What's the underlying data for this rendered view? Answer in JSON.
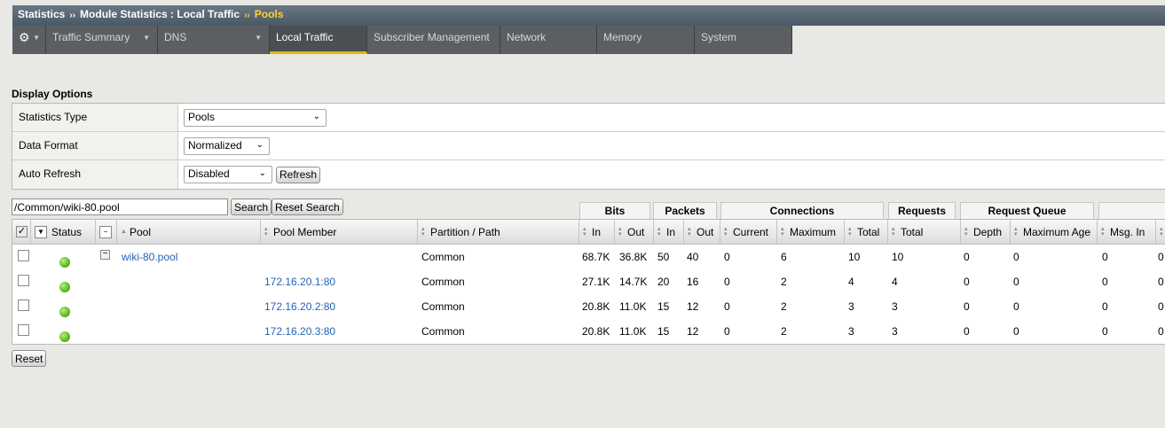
{
  "breadcrumb": {
    "root": "Statistics",
    "section": "Module Statistics : Local Traffic",
    "current": "Pools"
  },
  "nav": {
    "gear_icon": "gear-icon",
    "tabs": [
      {
        "label": "Traffic Summary",
        "dropdown": true
      },
      {
        "label": "DNS",
        "dropdown": true
      },
      {
        "label": "Local Traffic",
        "active": true
      },
      {
        "label": "Subscriber Management"
      },
      {
        "label": "Network"
      },
      {
        "label": "Memory"
      },
      {
        "label": "System"
      }
    ]
  },
  "display_options": {
    "heading": "Display Options",
    "statistics_type": {
      "label": "Statistics Type",
      "value": "Pools"
    },
    "data_format": {
      "label": "Data Format",
      "value": "Normalized"
    },
    "auto_refresh": {
      "label": "Auto Refresh",
      "value": "Disabled",
      "button": "Refresh"
    }
  },
  "search": {
    "value": "/Common/wiki-80.pool",
    "search_button": "Search",
    "reset_button": "Reset Search"
  },
  "groups": {
    "bits": "Bits",
    "packets": "Packets",
    "connections": "Connections",
    "requests": "Requests",
    "request_queue": "Request Queue"
  },
  "columns": {
    "status": "Status",
    "pool": "Pool",
    "pool_member": "Pool Member",
    "partition": "Partition / Path",
    "bits_in": "In",
    "bits_out": "Out",
    "pkts_in": "In",
    "pkts_out": "Out",
    "conn_current": "Current",
    "conn_max": "Maximum",
    "conn_total": "Total",
    "req_total": "Total",
    "q_depth": "Depth",
    "q_max_age": "Maximum Age",
    "msg_in": "Msg. In"
  },
  "rows": [
    {
      "pool": "wiki-80.pool",
      "member": "",
      "partition": "Common",
      "bits_in": "68.7K",
      "bits_out": "36.8K",
      "pkts_in": "50",
      "pkts_out": "40",
      "current": "0",
      "maximum": "6",
      "total": "10",
      "req_total": "10",
      "depth": "0",
      "max_age": "0",
      "msg_in": "0",
      "extra": "0"
    },
    {
      "pool": "",
      "member": "172.16.20.1:80",
      "partition": "Common",
      "bits_in": "27.1K",
      "bits_out": "14.7K",
      "pkts_in": "20",
      "pkts_out": "16",
      "current": "0",
      "maximum": "2",
      "total": "4",
      "req_total": "4",
      "depth": "0",
      "max_age": "0",
      "msg_in": "0",
      "extra": "0"
    },
    {
      "pool": "",
      "member": "172.16.20.2:80",
      "partition": "Common",
      "bits_in": "20.8K",
      "bits_out": "11.0K",
      "pkts_in": "15",
      "pkts_out": "12",
      "current": "0",
      "maximum": "2",
      "total": "3",
      "req_total": "3",
      "depth": "0",
      "max_age": "0",
      "msg_in": "0",
      "extra": "0"
    },
    {
      "pool": "",
      "member": "172.16.20.3:80",
      "partition": "Common",
      "bits_in": "20.8K",
      "bits_out": "11.0K",
      "pkts_in": "15",
      "pkts_out": "12",
      "current": "0",
      "maximum": "2",
      "total": "3",
      "req_total": "3",
      "depth": "0",
      "max_age": "0",
      "msg_in": "0",
      "extra": "0"
    }
  ],
  "reset_label": "Reset",
  "colors": {
    "status_available": "#5cb81e",
    "link": "#2563b5",
    "active_tab_accent": "#e8b600",
    "breadcrumb_current": "#ffd030"
  }
}
